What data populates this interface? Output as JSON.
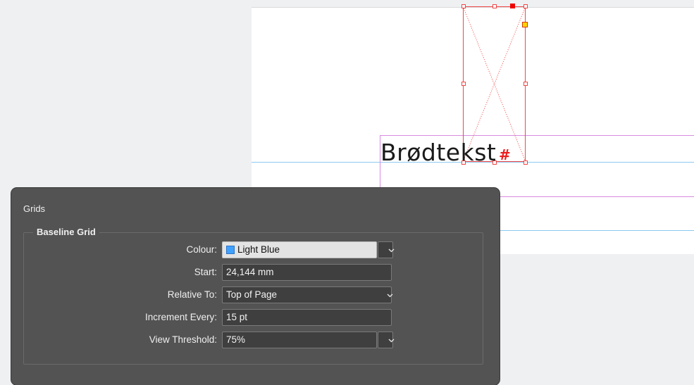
{
  "canvas": {
    "body_text": "Brødtekst",
    "overset_marker": "#",
    "colors": {
      "baseline_line": "#8cc9f0",
      "frame_stroke": "#ef4747",
      "margin_guide": "#d88be0"
    }
  },
  "dialog": {
    "title": "Grids",
    "baseline_grid": {
      "legend": "Baseline Grid",
      "colour": {
        "label": "Colour:",
        "value": "Light Blue",
        "swatch_color": "#3fa1ff"
      },
      "start": {
        "label": "Start:",
        "value": "24,144 mm"
      },
      "relative_to": {
        "label": "Relative To:",
        "value": "Top of Page"
      },
      "increment_every": {
        "label": "Increment Every:",
        "value": "15 pt"
      },
      "view_threshold": {
        "label": "View Threshold:",
        "value": "75%"
      }
    }
  }
}
